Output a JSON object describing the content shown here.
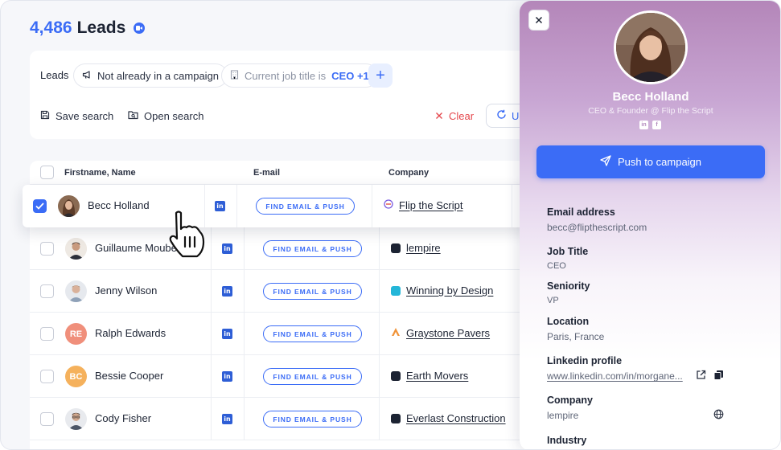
{
  "header": {
    "count": "4,486",
    "title": "Leads"
  },
  "filters": {
    "label": "Leads",
    "chip_campaign": "Not already in a campaign",
    "chip_job_prefix": "Current job title is",
    "chip_job_value": "CEO +1",
    "add": "+"
  },
  "actions": {
    "save": "Save search",
    "open": "Open search",
    "clear": "Clear",
    "update": "U"
  },
  "table": {
    "columns": [
      "Firstname, Name",
      "E-mail",
      "Company"
    ],
    "find_label": "FIND EMAIL & PUSH",
    "selected": {
      "name": "Becc Holland",
      "company": "Flip the Script"
    },
    "rows": [
      {
        "name": "Guillaume Moubeche",
        "initials": "",
        "company": "lempire"
      },
      {
        "name": "Jenny Wilson",
        "initials": "",
        "company": "Winning by Design"
      },
      {
        "name": "Ralph Edwards",
        "initials": "RE",
        "company": "Graystone Pavers"
      },
      {
        "name": "Bessie Cooper",
        "initials": "BC",
        "company": "Earth Movers"
      },
      {
        "name": "Cody Fisher",
        "initials": "",
        "company": "Everlast Construction"
      }
    ]
  },
  "panel": {
    "name": "Becc Holland",
    "role": "CEO & Founder @ Flip the Script",
    "push_label": "Push to campaign",
    "fields": [
      {
        "label": "Email address",
        "value": "becc@flipthescript.com"
      },
      {
        "label": "Job Title",
        "value": "CEO"
      },
      {
        "label": "Seniority",
        "value": "VP"
      },
      {
        "label": "Location",
        "value": "Paris, France"
      },
      {
        "label": "Linkedin profile",
        "value": "www.linkedin.com/in/morgane..."
      },
      {
        "label": "Company",
        "value": "lempire"
      },
      {
        "label": "Industry",
        "value": ""
      }
    ]
  },
  "colors": {
    "accent": "#3b6cf6",
    "danger": "#e5484d",
    "linkedin": "#2e5ed6"
  }
}
